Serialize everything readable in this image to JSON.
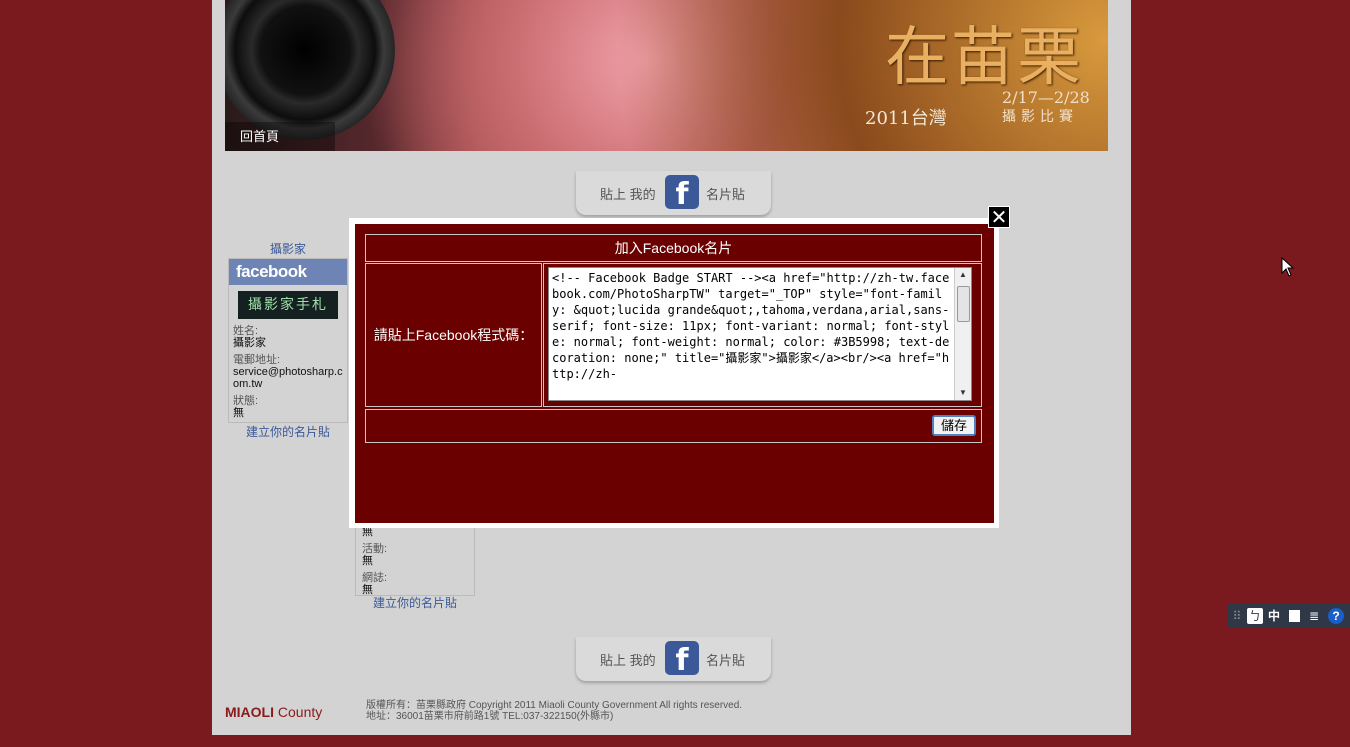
{
  "banner": {
    "home_link": "回首頁",
    "title": "在苗栗",
    "year_label": "2011台灣",
    "dates": "2/17—2/28",
    "subtitle": "攝影比賽"
  },
  "fb_tab": {
    "prefix": "貼上 我的",
    "logo": "f",
    "suffix": "名片貼"
  },
  "card1": {
    "title": "攝影家",
    "fb_brand": "facebook",
    "image_text": "攝影家手札",
    "fields": [
      {
        "label": "姓名:",
        "value": "攝影家"
      },
      {
        "label": "電郵地址:",
        "value": "service@photosharp.com.tw"
      },
      {
        "label": "狀態:",
        "value": "無"
      }
    ],
    "link": "建立你的名片貼"
  },
  "card2": {
    "top_value": "無",
    "fields": [
      {
        "label": "活動:",
        "value": "無"
      },
      {
        "label": "網誌:",
        "value": "無"
      }
    ],
    "link": "建立你的名片貼"
  },
  "modal": {
    "title": "加入Facebook名片",
    "field_label": "請貼上Facebook程式碼：",
    "code": "<!-- Facebook Badge START --><a href=\"http://zh-tw.facebook.com/PhotoSharpTW\" target=\"_TOP\" style=\"font-family: &quot;lucida grande&quot;,tahoma,verdana,arial,sans-serif; font-size: 11px; font-variant: normal; font-style: normal; font-weight: normal; color: #3B5998; text-decoration: none;\" title=\"攝影家\">攝影家</a><br/><a href=\"http://zh-",
    "save_label": "儲存",
    "close_glyph": "✕"
  },
  "footer": {
    "logo_bold": "MIAOLI",
    "logo_light": "County",
    "copyright": "版權所有：苗栗縣政府  Copyright 2011 Miaoli County Government All rights reserved.",
    "address": "地址：36001苗栗市府前路1號    TEL:037-322150(外縣市)"
  },
  "ime_toolbar": {
    "icons": [
      "ime-grip-icon",
      "ime-mode-icon",
      "ime-chinese-icon",
      "ime-fullwidth-icon",
      "ime-pad-icon",
      "ime-help-icon"
    ],
    "chinese_label": "中",
    "help_label": "?"
  },
  "colors": {
    "background": "#7a1a1e",
    "page": "#d3d3d3",
    "modal_body": "#6b0000",
    "facebook_blue": "#3b5998"
  }
}
